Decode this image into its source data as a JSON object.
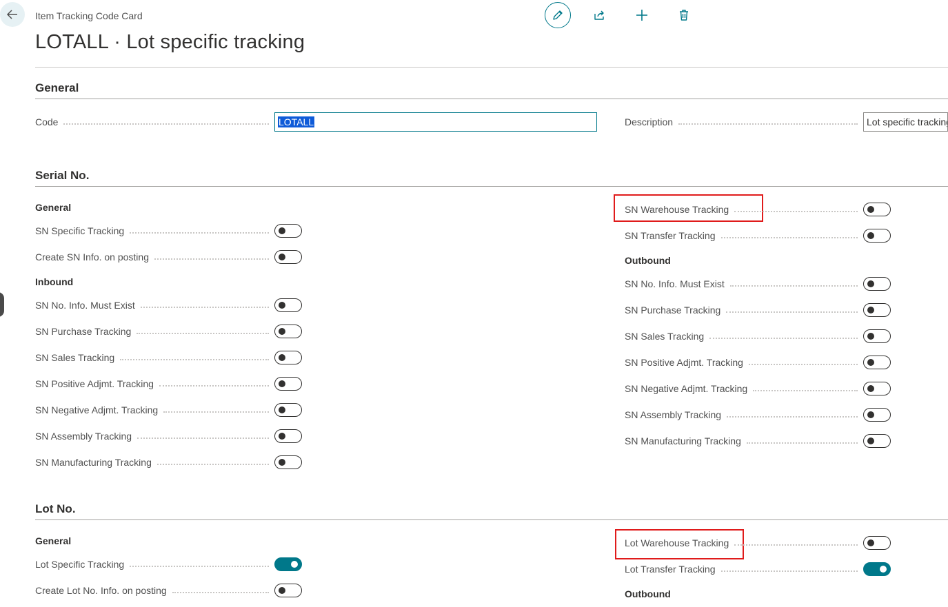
{
  "header": {
    "breadcrumb": "Item Tracking Code Card",
    "title": "LOTALL · Lot specific tracking",
    "toolbar": [
      {
        "name": "edit-icon"
      },
      {
        "name": "share-icon"
      },
      {
        "name": "add-icon"
      },
      {
        "name": "delete-icon"
      }
    ]
  },
  "general": {
    "title": "General",
    "code_label": "Code",
    "code_value": "LOTALL",
    "description_label": "Description",
    "description_value": "Lot specific tracking"
  },
  "serial": {
    "title": "Serial No.",
    "left": {
      "general_head": "General",
      "general_items": [
        {
          "label": "SN Specific Tracking",
          "on": false
        },
        {
          "label": "Create SN Info. on posting",
          "on": false
        }
      ],
      "inbound_head": "Inbound",
      "inbound_items": [
        {
          "label": "SN No. Info. Must Exist",
          "on": false
        },
        {
          "label": "SN Purchase Tracking",
          "on": false
        },
        {
          "label": "SN Sales Tracking",
          "on": false
        },
        {
          "label": "SN Positive Adjmt. Tracking",
          "on": false
        },
        {
          "label": "SN Negative Adjmt. Tracking",
          "on": false
        },
        {
          "label": "SN Assembly Tracking",
          "on": false
        },
        {
          "label": "SN Manufacturing Tracking",
          "on": false
        }
      ]
    },
    "right": {
      "top_items": [
        {
          "label": "SN Warehouse Tracking",
          "on": false
        },
        {
          "label": "SN Transfer Tracking",
          "on": false
        }
      ],
      "outbound_head": "Outbound",
      "outbound_items": [
        {
          "label": "SN No. Info. Must Exist",
          "on": false
        },
        {
          "label": "SN Purchase Tracking",
          "on": false
        },
        {
          "label": "SN Sales Tracking",
          "on": false
        },
        {
          "label": "SN Positive Adjmt. Tracking",
          "on": false
        },
        {
          "label": "SN Negative Adjmt. Tracking",
          "on": false
        },
        {
          "label": "SN Assembly Tracking",
          "on": false
        },
        {
          "label": "SN Manufacturing Tracking",
          "on": false
        }
      ]
    }
  },
  "lot": {
    "title": "Lot No.",
    "left": {
      "general_head": "General",
      "general_items": [
        {
          "label": "Lot Specific Tracking",
          "on": true
        },
        {
          "label": "Create Lot No. Info. on posting",
          "on": false
        }
      ]
    },
    "right": {
      "top_items": [
        {
          "label": "Lot Warehouse Tracking",
          "on": false
        },
        {
          "label": "Lot Transfer Tracking",
          "on": true
        }
      ],
      "outbound_head": "Outbound"
    }
  },
  "colors": {
    "accent": "#00788a",
    "highlight": "#e01b1b"
  }
}
